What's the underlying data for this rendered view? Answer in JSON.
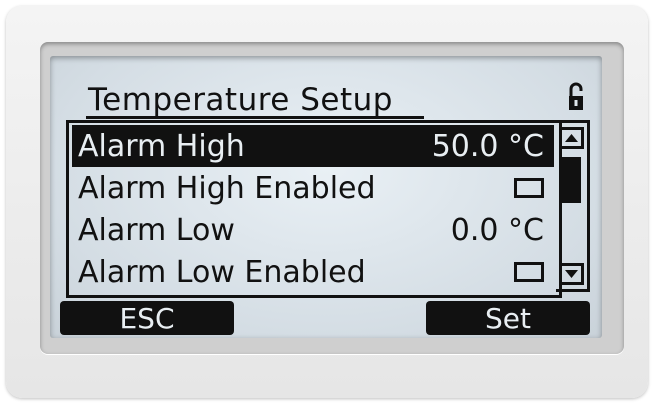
{
  "screen": {
    "title": "Temperature Setup",
    "lock_state": "unlocked"
  },
  "menu": {
    "items": [
      {
        "label": "Alarm High",
        "value": "50.0 °C",
        "selected": true
      },
      {
        "label": "Alarm High Enabled",
        "value": "",
        "checkbox": false
      },
      {
        "label": "Alarm Low",
        "value": "0.0 °C",
        "selected": false
      },
      {
        "label": "Alarm Low Enabled",
        "value": "",
        "checkbox": false
      }
    ]
  },
  "softkeys": {
    "left": "ESC",
    "right": "Set"
  },
  "colors": {
    "lcd_background": "#dfe6ec",
    "ink": "#111111",
    "bezel": "#cfcfcf"
  }
}
